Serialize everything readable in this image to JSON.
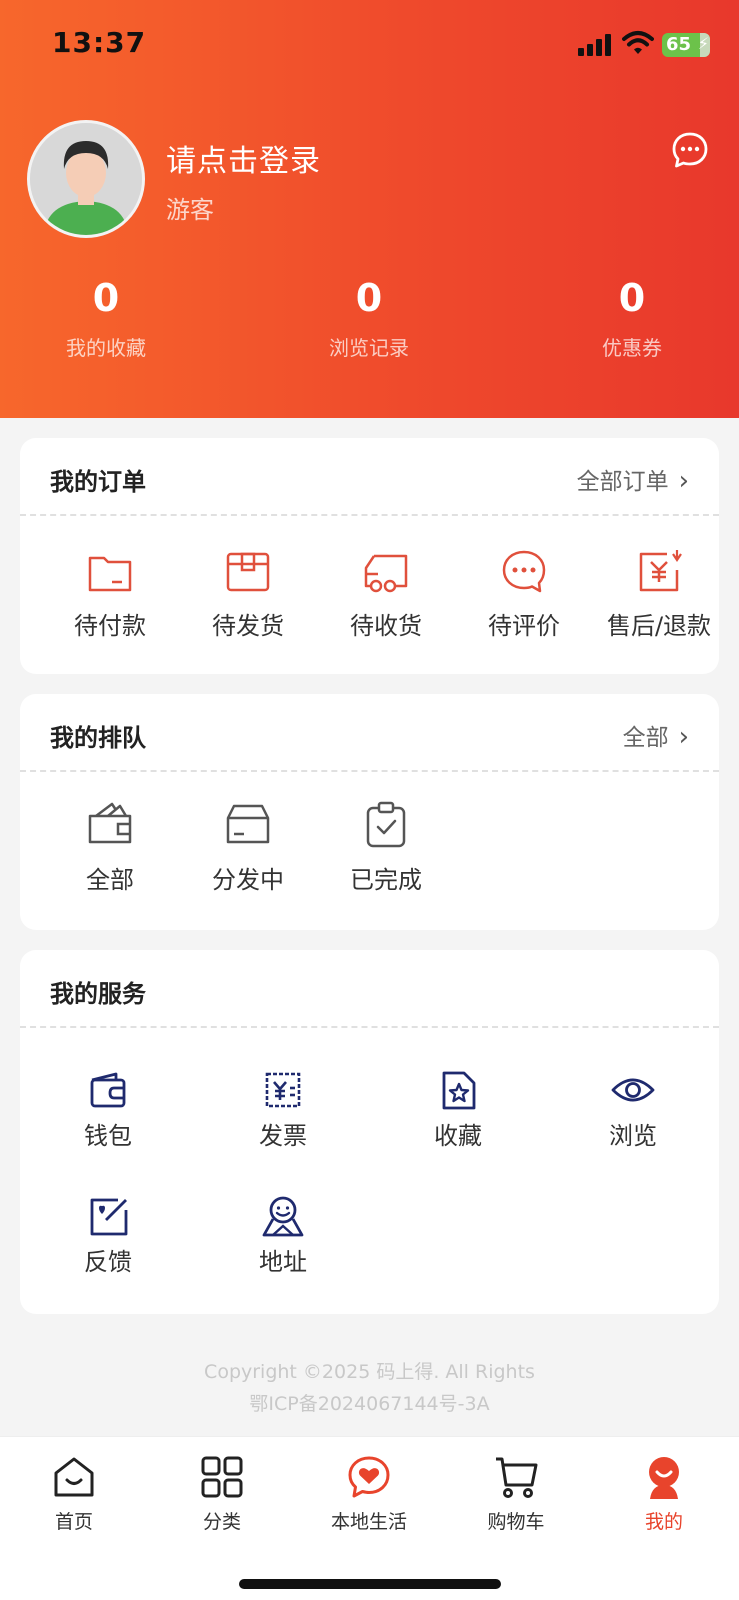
{
  "status_bar": {
    "time": "13:37",
    "battery": "65"
  },
  "profile": {
    "title": "请点击登录",
    "subtitle": "游客"
  },
  "stats": [
    {
      "value": "0",
      "label": "我的收藏"
    },
    {
      "value": "0",
      "label": "浏览记录"
    },
    {
      "value": "0",
      "label": "优惠券"
    }
  ],
  "orders": {
    "title": "我的订单",
    "more": "全部订单",
    "items": [
      {
        "label": "待付款",
        "icon": "wallet-card-icon"
      },
      {
        "label": "待发货",
        "icon": "package-icon"
      },
      {
        "label": "待收货",
        "icon": "truck-icon"
      },
      {
        "label": "待评价",
        "icon": "chat-bubble-icon"
      },
      {
        "label": "售后/退款",
        "icon": "refund-icon"
      }
    ]
  },
  "queue": {
    "title": "我的排队",
    "more": "全部",
    "items": [
      {
        "label": "全部",
        "icon": "wallet-icon"
      },
      {
        "label": "分发中",
        "icon": "box-icon"
      },
      {
        "label": "已完成",
        "icon": "clipboard-check-icon"
      }
    ]
  },
  "services": {
    "title": "我的服务",
    "items": [
      {
        "label": "钱包",
        "icon": "wallet-icon"
      },
      {
        "label": "发票",
        "icon": "invoice-icon"
      },
      {
        "label": "收藏",
        "icon": "star-document-icon"
      },
      {
        "label": "浏览",
        "icon": "eye-icon"
      },
      {
        "label": "反馈",
        "icon": "edit-icon"
      },
      {
        "label": "地址",
        "icon": "location-person-icon"
      }
    ]
  },
  "footer": {
    "copyright": "Copyright ©2025 码上得. All Rights",
    "icp": "鄂ICP备2024067144号-3A"
  },
  "tabbar": {
    "items": [
      {
        "label": "首页",
        "icon": "home-icon"
      },
      {
        "label": "分类",
        "icon": "grid-icon"
      },
      {
        "label": "本地生活",
        "icon": "heart-chat-icon"
      },
      {
        "label": "购物车",
        "icon": "cart-icon"
      },
      {
        "label": "我的",
        "icon": "profile-icon"
      }
    ],
    "active_index": 4
  },
  "colors": {
    "header_start": "#f7672c",
    "header_end": "#e8382c",
    "order_icon": "#e0503c",
    "queue_icon": "#555555",
    "service_icon": "#1f2a6e",
    "active_tab": "#e8442c"
  }
}
